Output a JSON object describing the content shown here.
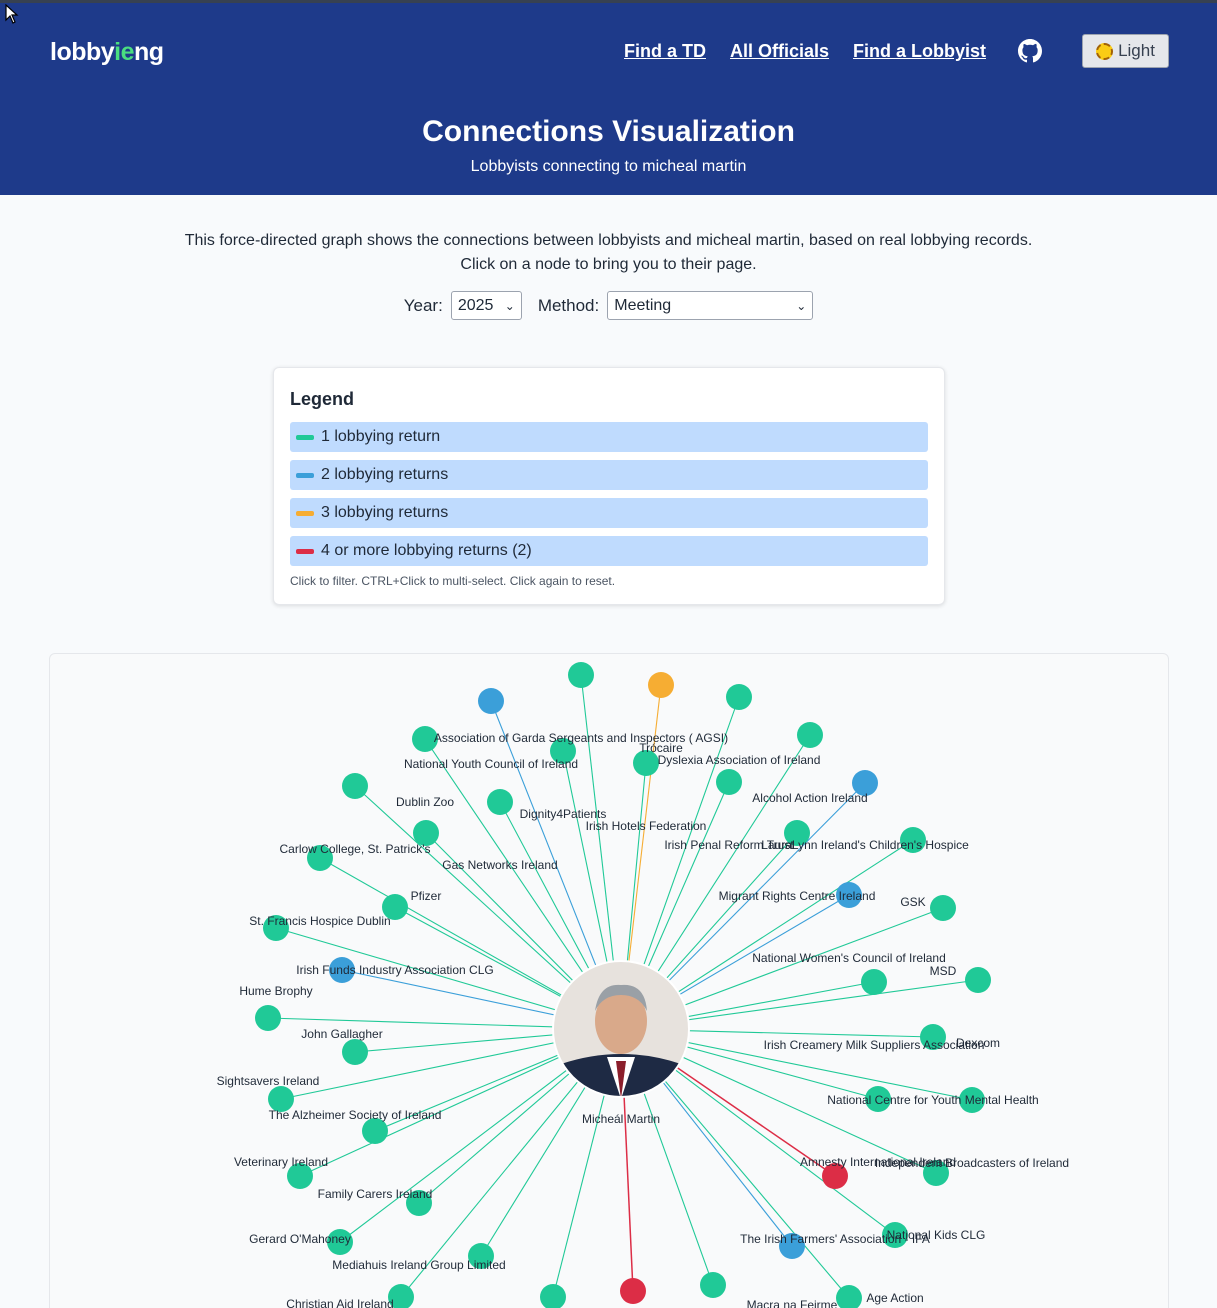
{
  "header": {
    "logo": {
      "pre": "lobby",
      "mid": "ie",
      "post": "ng"
    },
    "nav": [
      "Find a TD",
      "All Officials",
      "Find a Lobbyist"
    ],
    "theme_button": "Light",
    "title": "Connections Visualization",
    "subtitle": "Lobbyists connecting to micheal martin"
  },
  "intro": {
    "line1": "This force-directed graph shows the connections between lobbyists and micheal martin, based on real lobbying records.",
    "line2": "Click on a node to bring you to their page."
  },
  "filters": {
    "year_label": "Year:",
    "year_value": "2025",
    "method_label": "Method:",
    "method_value": "Meeting"
  },
  "legend": {
    "title": "Legend",
    "items": [
      {
        "label": "1 lobbying return",
        "color": "#20c997"
      },
      {
        "label": "2 lobbying returns",
        "color": "#3b9fd9"
      },
      {
        "label": "3 lobbying returns",
        "color": "#f6ad33"
      },
      {
        "label": "4 or more lobbying returns (2)",
        "color": "#dc2d46"
      }
    ],
    "note": "Click to filter. CTRL+Click to multi-select. Click again to reset."
  },
  "graph": {
    "center_name": "Micheál Martin",
    "colors": {
      "c1": "#20c997",
      "c2": "#3b9fd9",
      "c3": "#f6ad33",
      "c4": "#dc2d46"
    },
    "lobbyists": [
      "Association of Garda Sergeants and Inspectors ( AGSI)",
      "Trócaire",
      "National Youth Council of Ireland",
      "Dyslexia Association of Ireland",
      "Alcohol Action Ireland",
      "Dublin Zoo",
      "Dignity4Patients",
      "Irish Hotels Federation",
      "Irish Penal Reform Trust",
      "LauraLynn Ireland's Children's Hospice",
      "Carlow College, St. Patrick's",
      "Gas Networks Ireland",
      "Pfizer",
      "Migrant Rights Centre Ireland",
      "GSK",
      "St. Francis Hospice Dublin",
      "National Women's Council of Ireland",
      "Irish Funds Industry Association CLG",
      "MSD",
      "Hume Brophy",
      "John Gallagher",
      "Dexcom",
      "Irish Creamery Milk Suppliers Association",
      "Sightsavers Ireland",
      "National Centre for Youth Mental Health",
      "The Alzheimer Society of Ireland",
      "Veterinary Ireland",
      "Amnesty International Ireland",
      "Independent Broadcasters of Ireland",
      "Family Carers Ireland",
      "Gerard O'Mahoney",
      "The Irish Farmers' Association - IFA",
      "National Kids CLG",
      "Mediahuis Ireland Group Limited",
      "Christian Aid Ireland",
      "Age Action",
      "Macra na Feirme"
    ]
  }
}
